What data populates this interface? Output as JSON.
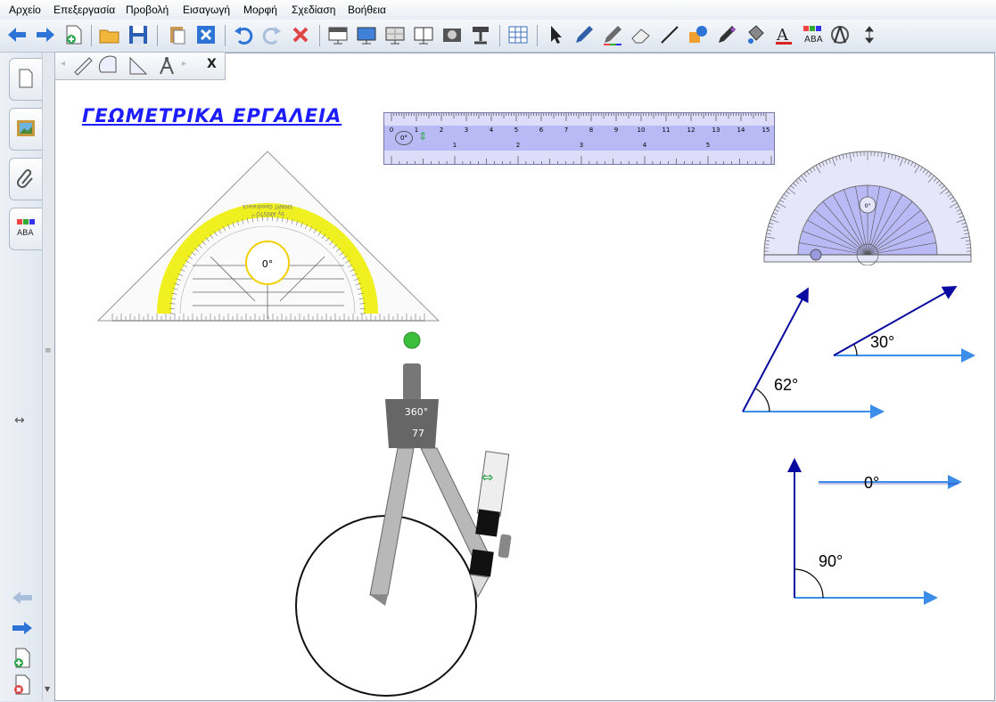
{
  "menu": {
    "items": [
      "Αρχείο",
      "Επεξεργασία",
      "Προβολή",
      "Εισαγωγή",
      "Μορφή",
      "Σχεδίαση",
      "Βοήθεια"
    ]
  },
  "toolbar": {
    "icons": [
      "back-arrow-icon",
      "forward-arrow-icon",
      "new-page-icon",
      "open-folder-icon",
      "save-icon",
      "paste-icon",
      "delete-page-icon",
      "undo-icon",
      "redo-icon",
      "delete-icon",
      "screen-shade-icon",
      "full-screen-icon",
      "transparent-background-icon",
      "dual-page-icon",
      "screen-capture-icon",
      "document-camera-icon",
      "table-icon",
      "select-icon",
      "pen-icon",
      "creative-pen-icon",
      "eraser-icon",
      "line-icon",
      "shapes-icon",
      "magic-pen-icon",
      "fill-icon",
      "text-icon",
      "properties-icon",
      "measurement-tools-icon",
      "move-toolbar-icon"
    ]
  },
  "mini_toolbar": {
    "close_label": "X",
    "tools": [
      "ruler-tool-icon",
      "protractor-tool-icon",
      "geodreieck-tool-icon",
      "compass-tool-icon"
    ]
  },
  "page": {
    "title": "ΓΕΩΜΕΤΡΙΚΑ ΕΡΓΑΛΕΙΑ"
  },
  "geodreieck": {
    "center_label": "0°",
    "brand_line1": "SMART Geodreieck",
    "brand_line2": "by ARISTO™"
  },
  "ruler": {
    "cm_labels": [
      "0",
      "1",
      "2",
      "3",
      "4",
      "5",
      "6",
      "7",
      "8",
      "9",
      "10",
      "11",
      "12",
      "13",
      "14",
      "15"
    ],
    "inch_labels": [
      "1",
      "2",
      "3",
      "4",
      "5"
    ],
    "angle_label": "0°"
  },
  "protractor": {
    "center_label": "0°"
  },
  "compass": {
    "angle_label": "360°",
    "radius_label": "77"
  },
  "angles": [
    {
      "label": "30°"
    },
    {
      "label": "62°"
    },
    {
      "label": "0°"
    },
    {
      "label": "90°"
    }
  ],
  "colors": {
    "title": "#1c1cff",
    "ray_dark": "#0a0aa0",
    "ray_light": "#3b8de8",
    "highlight": "#f0f020",
    "ruler_fill": "#b9b9f5"
  }
}
